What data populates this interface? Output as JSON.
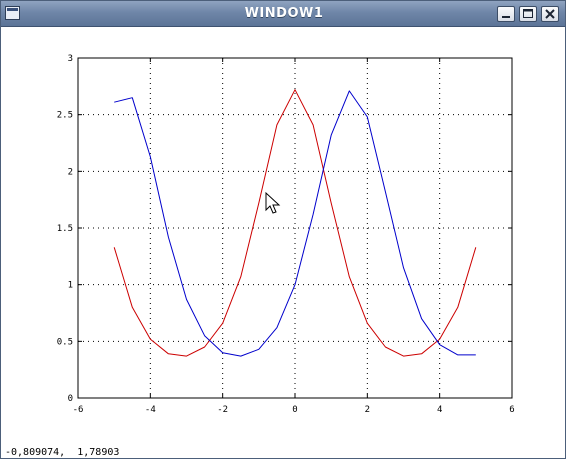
{
  "window": {
    "title": "WINDOW1",
    "sys_icon": "window-menu-icon",
    "buttons": {
      "minimize_icon": "minimize-icon",
      "maximize_icon": "maximize-icon",
      "close_icon": "close-icon"
    }
  },
  "status_bar": {
    "coordinates": "-0,809074,  1,78903"
  },
  "cursor_icon": "arrow-pointer-icon",
  "colors": {
    "series_1": "#cc0000",
    "series_2": "#0000cc",
    "titlebar": "#6f86a8"
  },
  "chart_data": {
    "type": "line",
    "title": "",
    "xlabel": "",
    "ylabel": "",
    "xlim": [
      -6,
      6
    ],
    "ylim": [
      0,
      3
    ],
    "x_ticks": [
      "-6",
      "-4",
      "-2",
      "0",
      "2",
      "4",
      "6"
    ],
    "y_ticks": [
      "0",
      "0.5",
      "1",
      "1.5",
      "2",
      "2.5",
      "3"
    ],
    "grid": true,
    "grid_style": "dotted",
    "legend": "none",
    "series": [
      {
        "color": "#cc0000",
        "x": [
          -5.0,
          -4.5,
          -4.0,
          -3.5,
          -3.0,
          -2.5,
          -2.0,
          -1.5,
          -1.0,
          -0.5,
          0.0,
          0.5,
          1.0,
          1.5,
          2.0,
          2.5,
          3.0,
          3.5,
          4.0,
          4.5,
          5.0
        ],
        "y": [
          1.33,
          0.8,
          0.52,
          0.39,
          0.37,
          0.45,
          0.66,
          1.07,
          1.72,
          2.41,
          2.72,
          2.41,
          1.72,
          1.07,
          0.66,
          0.45,
          0.37,
          0.39,
          0.52,
          0.8,
          1.33
        ]
      },
      {
        "color": "#0000cc",
        "x": [
          -5.0,
          -4.5,
          -4.0,
          -3.5,
          -3.0,
          -2.5,
          -2.0,
          -1.5,
          -1.0,
          -0.5,
          0.0,
          0.5,
          1.0,
          1.5,
          2.0,
          2.5,
          3.0,
          3.5,
          4.0,
          4.5,
          5.0
        ],
        "y": [
          2.61,
          2.65,
          2.13,
          1.42,
          0.87,
          0.55,
          0.4,
          0.37,
          0.43,
          0.62,
          1.0,
          1.62,
          2.32,
          2.71,
          2.48,
          1.82,
          1.15,
          0.7,
          0.47,
          0.38,
          0.38
        ]
      }
    ]
  }
}
